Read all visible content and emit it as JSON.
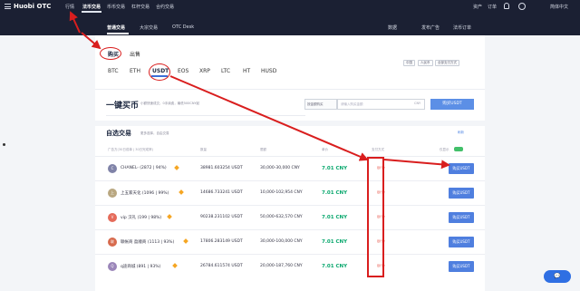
{
  "topnav": {
    "logo": "Huobi OTC",
    "items": [
      "行情",
      "法币交易",
      "币币交易",
      "杠杆交易",
      "合约交易"
    ],
    "right": [
      "资产",
      "订单",
      "简体中文"
    ]
  },
  "subnav": {
    "tabs": [
      "普通交易",
      "大宗交易",
      "OTC Desk"
    ],
    "right": [
      "数据",
      "发布广告",
      "法币订单"
    ]
  },
  "trade": {
    "buy_label": "购买",
    "sell_label": "出售",
    "coins": [
      "BTC",
      "ETH",
      "USDT",
      "EOS",
      "XRP",
      "LTC",
      "HT",
      "HUSD"
    ],
    "filters": [
      "中国",
      "人民币",
      "全部支付方式"
    ]
  },
  "quick_buy": {
    "title": "一键买币",
    "desc": "小额快速成交，0手续费，最低500CNY起",
    "select": "按金额购买",
    "placeholder": "请输入购买金额",
    "unit": "CNY",
    "button": "购买USDT"
  },
  "list": {
    "title": "自选交易",
    "desc": "更多选择，自由交易",
    "refresh": "刷新",
    "columns": [
      "广告方(30日成单 | 30日完成率)",
      "数量",
      "限额",
      "单价",
      "支付方式",
      "操作"
    ],
    "toggle_label": "仅显示",
    "rows": [
      {
        "initial": "C",
        "merchant": "CHANEL- (2872 | 94%)",
        "qty": "38981.603254 USDT",
        "limit": "30,000-30,000 CNY",
        "price": "7.01 CNY",
        "pay": "银行卡",
        "button": "购买USDT"
      },
      {
        "initial": "上",
        "merchant": "上五家天化 (1096 | 99%)",
        "qty": "14686.733241 USDT",
        "limit": "10,000-102,954 CNY",
        "price": "7.01 CNY",
        "pay": "银行卡",
        "button": "购买USDT"
      },
      {
        "initial": "V",
        "merchant": "vip 汉礼 (199 | 98%)",
        "qty": "90238.231102 USDT",
        "limit": "50,000-632,570 CNY",
        "price": "7.01 CNY",
        "pay": "银行卡",
        "button": "购买USDT"
      },
      {
        "initial": "联",
        "merchant": "联帐商 盈顺商 (1113 | 93%)",
        "qty": "17806.283149 USDT",
        "limit": "30,000-100,000 CNY",
        "price": "7.01 CNY",
        "pay": "银行卡",
        "button": "购买USDT"
      },
      {
        "initial": "Q",
        "merchant": "q途商城 (891 | 93%)",
        "qty": "26784.611574 USDT",
        "limit": "20,000-187,760 CNY",
        "price": "7.01 CNY",
        "pay": "银行卡",
        "button": "购买USDT"
      }
    ]
  },
  "chat_label": "💬"
}
